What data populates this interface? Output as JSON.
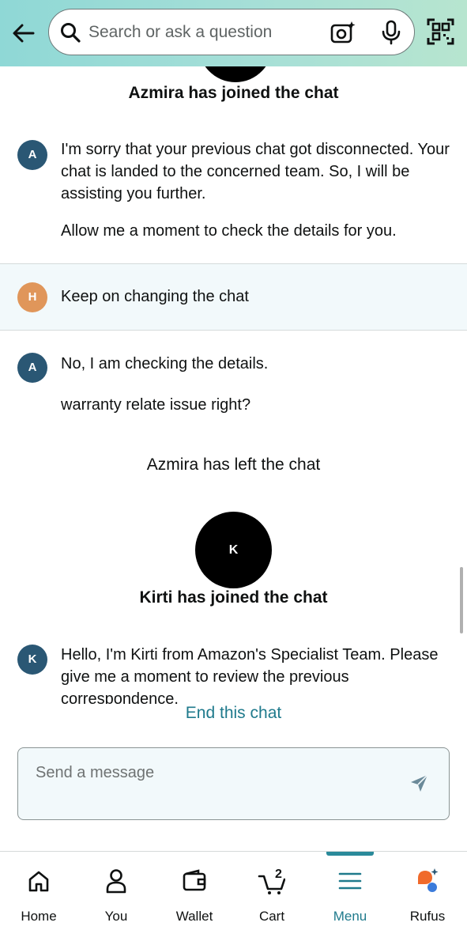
{
  "search": {
    "placeholder": "Search or ask a question"
  },
  "chat": {
    "agent1_joined": "Azmira has joined the chat",
    "msg1_avatar": "A",
    "msg1_line1": "I'm sorry that your previous chat got disconnected. Your chat is landed to the concerned team. So, I will be assisting you further.",
    "msg1_line2": "Allow me a moment to check the details for you.",
    "user_avatar": "H",
    "user_msg": "Keep on changing the chat",
    "msg2_avatar": "A",
    "msg2_line1": "No, I am checking the details.",
    "msg2_line2": "warranty relate issue right?",
    "agent1_left": "Azmira has left the chat",
    "agent2_avatar_big": "K",
    "agent2_joined": "Kirti has joined the chat",
    "msg3_avatar": "K",
    "msg3_text": "Hello, I'm Kirti from Amazon's Specialist Team. Please give me a moment to review the previous correspondence."
  },
  "end_chat_label": "End this chat",
  "composer": {
    "placeholder": "Send a message"
  },
  "nav": {
    "home": "Home",
    "you": "You",
    "wallet": "Wallet",
    "cart": "Cart",
    "cart_count": "2",
    "menu": "Menu",
    "rufus": "Rufus"
  },
  "colors": {
    "accent": "#1f7a8c",
    "agent_avatar": "#2a5774",
    "user_avatar": "#e0965a",
    "header_gradient_start": "#8fd8d6",
    "header_gradient_end": "#b7e5cf"
  }
}
